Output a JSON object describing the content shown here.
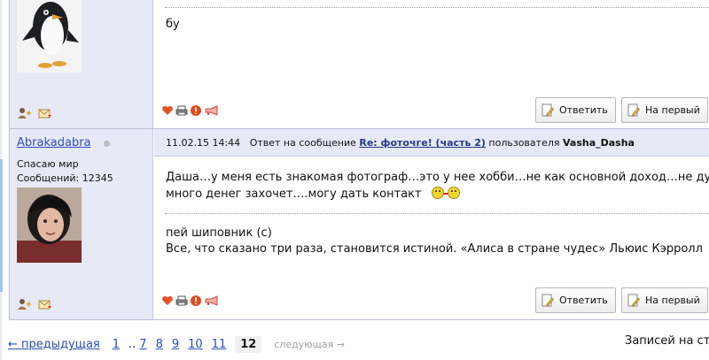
{
  "posts": [
    {
      "message_lines": [
        "бу"
      ],
      "actions": {
        "reply": "Ответить",
        "to_first": "На первый"
      }
    },
    {
      "header": {
        "datetime": "11.02.15 14:44",
        "reply_prefix": "Ответ на сообщение",
        "topic_link": "Re: фоточге! (часть 2)",
        "user_prefix": "пользователя",
        "user": "Vasha_Dasha"
      },
      "author": {
        "name": "Abrakadabra",
        "status": "Спасаю мир",
        "posts_label": "Сообщений: 12345"
      },
      "message_lines": [
        "Даша…у меня есть знакомая фотограф…это у нее хобби…не как основной доход…не дум",
        "много денег захочет….могу дать контакт"
      ],
      "signature_lines": [
        "пей шиповник (с)",
        "Все, что сказано три раза, становится истиной. «Алиса в стране чудес» Льюис Кэрролл"
      ],
      "actions": {
        "reply": "Ответить",
        "to_first": "На первый"
      }
    }
  ],
  "pagination": {
    "prev": "← предыдущая",
    "first": "1",
    "dots": "..",
    "pages": [
      "7",
      "8",
      "9",
      "10",
      "11"
    ],
    "current": "12",
    "next": "следующая →"
  },
  "records_label": "Записей на ст",
  "colors": {
    "sidebar_bg": "#e8e9f7",
    "link": "#2b4eb6",
    "border": "#b9bfd9"
  }
}
